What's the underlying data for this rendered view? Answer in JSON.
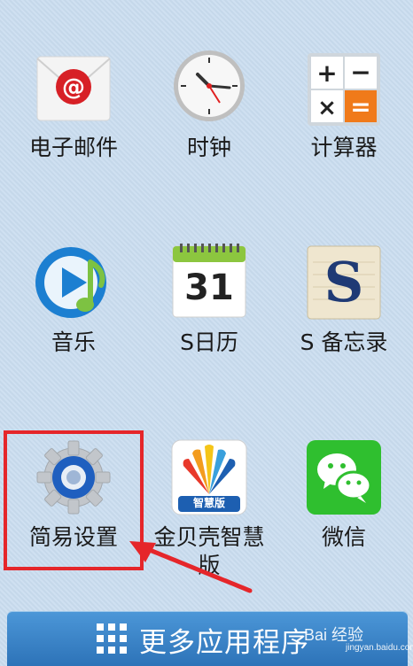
{
  "apps": [
    {
      "label": "电子邮件",
      "icon": "email-icon"
    },
    {
      "label": "时钟",
      "icon": "clock-icon"
    },
    {
      "label": "计算器",
      "icon": "calculator-icon"
    },
    {
      "label": "音乐",
      "icon": "music-icon"
    },
    {
      "label": "S日历",
      "icon": "calendar-icon",
      "calendar_day": "31"
    },
    {
      "label": "S 备忘录",
      "icon": "memo-icon",
      "memo_letter": "S"
    },
    {
      "label": "简易设置",
      "icon": "settings-gear-icon"
    },
    {
      "label": "金贝壳智慧",
      "label_line2": "版",
      "icon": "jinbeike-icon",
      "badge": "智慧版"
    },
    {
      "label": "微信",
      "icon": "wechat-icon"
    }
  ],
  "bottom_bar": {
    "label": "更多应用程序",
    "icon": "grid-icon"
  },
  "watermark": {
    "text": "Bai 经验",
    "url": "jingyan.baidu.com"
  },
  "colors": {
    "highlight": "#e5262a",
    "bottom_bar": "#3a86cc",
    "wechat": "#2fbf2f",
    "calculator_orange": "#f07a1a"
  }
}
